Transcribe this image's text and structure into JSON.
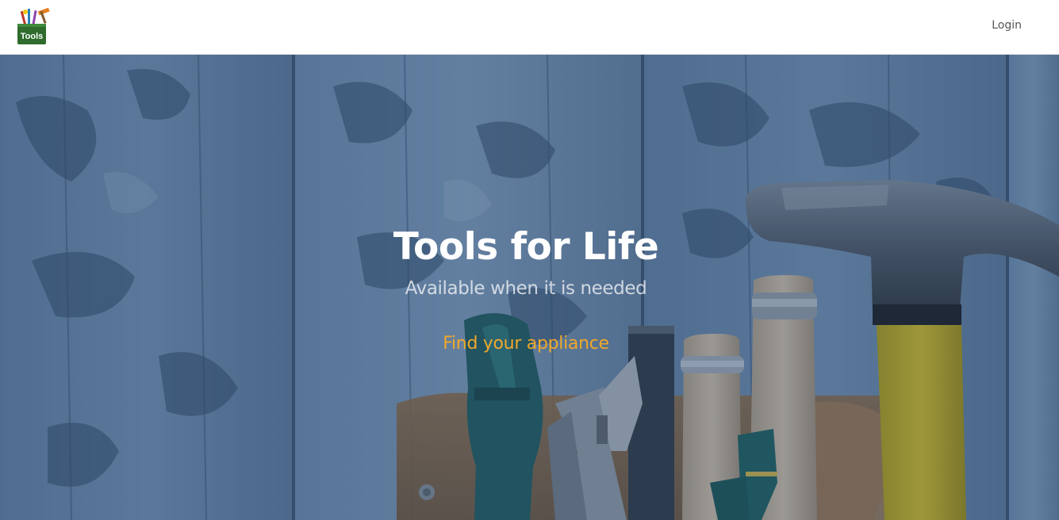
{
  "navbar": {
    "logo_text": "Tools",
    "login_label": "Login"
  },
  "hero": {
    "title": "Tools for Life",
    "subtitle": "Available when it is needed",
    "cta_label": "Find your appliance"
  },
  "colors": {
    "accent": "#f0a92a",
    "overlay": "#284269",
    "logo_green": "#2e6b2c"
  },
  "icons": [
    "tools-logo-icon",
    "hammer-icon",
    "screwdriver-icon",
    "pliers-icon",
    "chisel-icon"
  ]
}
